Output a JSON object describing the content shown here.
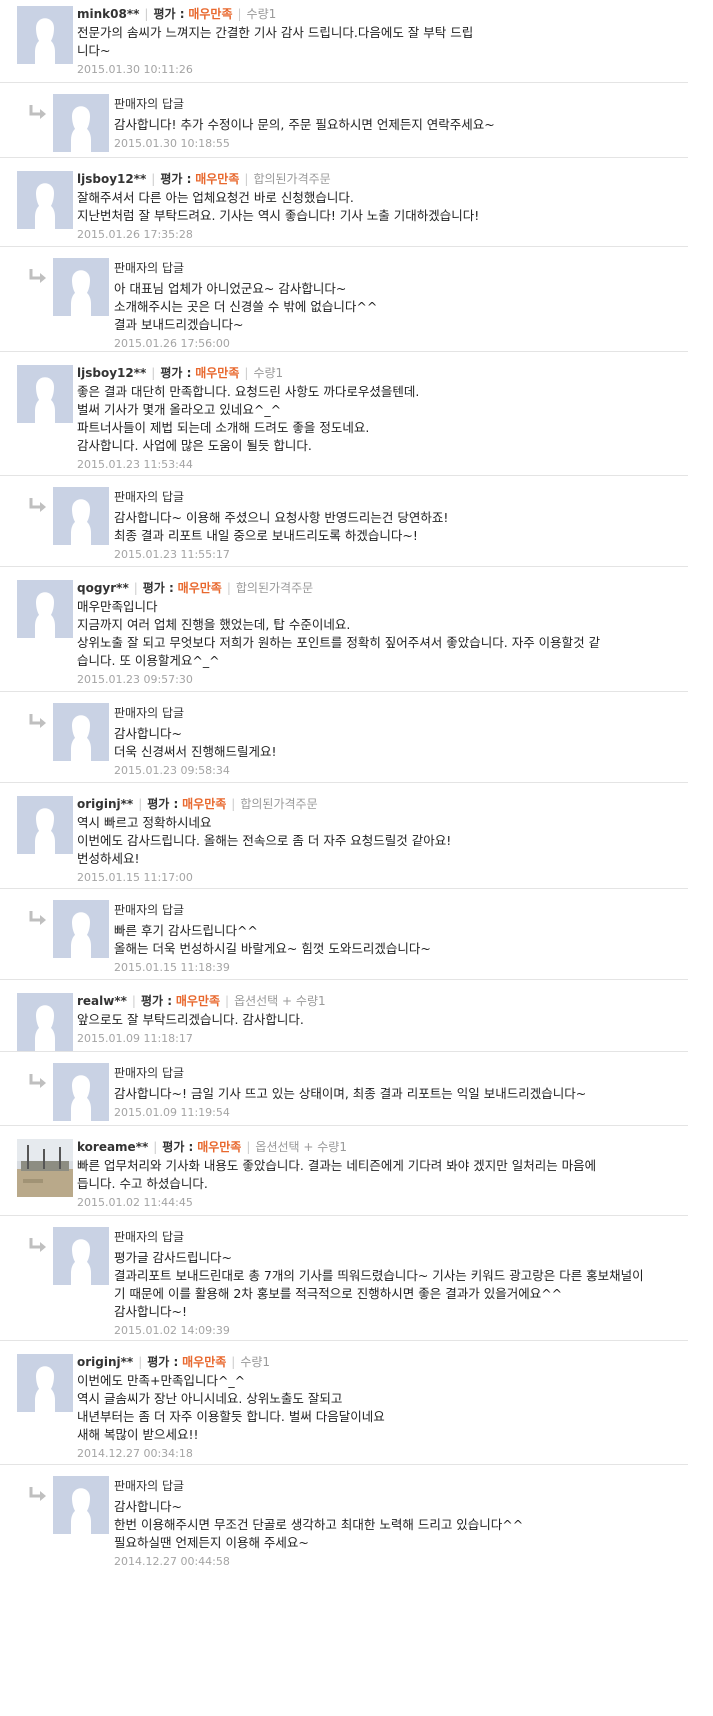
{
  "labels": {
    "rating_label": "평가 :",
    "seller_reply_title": "판매자의 답글"
  },
  "colors": {
    "rating": "#e8682e",
    "date": "#a4a4a4",
    "avatar": "#c9d2e4",
    "separator": "#e4e4e4"
  },
  "reviews": [
    {
      "user": "mink08**",
      "rating": "매우만족",
      "option": "수량1",
      "lines": [
        "전문가의 솜씨가 느껴지는 간결한 기사 감사 드립니다.다음에도 잘 부탁 드립",
        "니다~"
      ],
      "date": "2015.01.30 10:11:26",
      "reply": {
        "lines": [
          "감사합니다! 추가 수정이나 문의, 주문 필요하시면 언제든지 연락주세요~"
        ],
        "date": "2015.01.30 10:18:55"
      }
    },
    {
      "user": "ljsboy12**",
      "rating": "매우만족",
      "option": "합의된가격주문",
      "lines": [
        "잘해주셔서 다른 아는 업체요청건 바로 신청했습니다.",
        "지난번처럼 잘 부탁드려요. 기사는 역시 좋습니다! 기사 노출 기대하겠습니다!"
      ],
      "date": "2015.01.26 17:35:28",
      "reply": {
        "lines": [
          "아 대표님 업체가 아니었군요~ 감사합니다~",
          "소개해주시는 곳은 더 신경쓸 수 밖에 없습니다^^",
          "결과 보내드리겠습니다~"
        ],
        "date": "2015.01.26 17:56:00"
      }
    },
    {
      "user": "ljsboy12**",
      "rating": "매우만족",
      "option": "수량1",
      "lines": [
        "좋은 결과 대단히 만족합니다. 요청드린 사항도 까다로우셨을텐데.",
        "벌써 기사가 몇개 올라오고 있네요^_^",
        "파트너사들이 제법 되는데 소개해 드려도 좋을 정도네요.",
        "감사합니다. 사업에 많은 도움이 될듯 합니다."
      ],
      "date": "2015.01.23 11:53:44",
      "reply": {
        "lines": [
          "감사합니다~ 이용해 주셨으니 요청사항 반영드리는건 당연하죠!",
          "최종 결과 리포트 내일 중으로 보내드리도록 하겠습니다~!"
        ],
        "date": "2015.01.23 11:55:17"
      }
    },
    {
      "user": "qogyr**",
      "rating": "매우만족",
      "option": "합의된가격주문",
      "lines": [
        "매우만족입니다",
        "지금까지 여러 업체 진행을 했었는데, 탑 수준이네요.",
        "상위노출 잘 되고 무엇보다 저희가 원하는 포인트를 정확히 짚어주셔서 좋았습니다. 자주 이용할것 같",
        "습니다. 또 이용할게요^_^"
      ],
      "date": "2015.01.23 09:57:30",
      "reply": {
        "lines": [
          "감사합니다~",
          "더욱 신경써서 진행해드릴게요!"
        ],
        "date": "2015.01.23 09:58:34"
      }
    },
    {
      "user": "originj**",
      "rating": "매우만족",
      "option": "합의된가격주문",
      "lines": [
        "역시 빠르고 정확하시네요",
        "이번에도 감사드립니다. 올해는 전속으로 좀 더 자주 요청드릴것 같아요!",
        "번성하세요!"
      ],
      "date": "2015.01.15 11:17:00",
      "reply": {
        "lines": [
          "빠른 후기 감사드립니다^^",
          "올해는 더욱 번성하시길 바랄게요~ 힘껏 도와드리겠습니다~"
        ],
        "date": "2015.01.15 11:18:39"
      }
    },
    {
      "user": "realw**",
      "rating": "매우만족",
      "option": "옵션선택 + 수량1",
      "lines": [
        "앞으로도 잘 부탁드리겠습니다. 감사합니다."
      ],
      "date": "2015.01.09 11:18:17",
      "reply": {
        "lines": [
          "감사합니다~! 금일 기사 뜨고 있는 상태이며, 최종 결과 리포트는 익일 보내드리겠습니다~"
        ],
        "date": "2015.01.09 11:19:54"
      }
    },
    {
      "user": "koreame**",
      "rating": "매우만족",
      "option": "옵션선택 + 수량1",
      "photo": true,
      "lines": [
        "빠른 업무처리와 기사화 내용도 좋았습니다. 결과는 네티즌에게 기다려 봐야 겠지만 일처리는 마음에",
        "듭니다. 수고 하셨습니다."
      ],
      "date": "2015.01.02 11:44:45",
      "reply": {
        "lines": [
          "평가글 감사드립니다~",
          "결과리포트 보내드린대로 총 7개의 기사를 띄워드렸습니다~ 기사는 키워드 광고랑은 다른 홍보채널이",
          "기 때문에 이를 활용해 2차 홍보를 적극적으로 진행하시면 좋은 결과가 있을거에요^^",
          "감사합니다~!"
        ],
        "date": "2015.01.02 14:09:39"
      }
    },
    {
      "user": "originj**",
      "rating": "매우만족",
      "option": "수량1",
      "lines": [
        "이번에도 만족+만족입니다^_^",
        "역시 글솜씨가 장난 아니시네요. 상위노출도 잘되고",
        "내년부터는 좀 더 자주 이용할듯 합니다. 벌써 다음달이네요",
        "새해 복많이 받으세요!!"
      ],
      "date": "2014.12.27 00:34:18",
      "reply": {
        "lines": [
          "감사합니다~",
          "한번 이용해주시면 무조건 단골로 생각하고 최대한 노력해 드리고 있습니다^^",
          "필요하실땐 언제든지 이용해 주세요~"
        ],
        "date": "2014.12.27 00:44:58"
      }
    }
  ]
}
